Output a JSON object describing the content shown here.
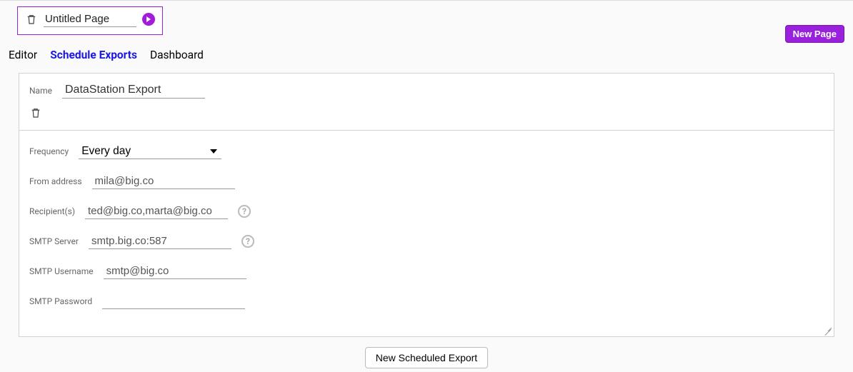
{
  "header": {
    "page_title": "Untitled Page",
    "new_page_button": "New Page"
  },
  "tabs": {
    "editor": "Editor",
    "schedule": "Schedule Exports",
    "dashboard": "Dashboard",
    "active": "schedule"
  },
  "export": {
    "name_label": "Name",
    "name_value": "DataStation Export",
    "frequency_label": "Frequency",
    "frequency_value": "Every day",
    "from_label": "From address",
    "from_value": "mila@big.co",
    "recipients_label": "Recipient(s)",
    "recipients_value": "ted@big.co,marta@big.co",
    "server_label": "SMTP Server",
    "server_value": "smtp.big.co:587",
    "username_label": "SMTP Username",
    "username_value": "smtp@big.co",
    "password_label": "SMTP Password",
    "password_value": ""
  },
  "footer": {
    "new_export_button": "New Scheduled Export"
  }
}
